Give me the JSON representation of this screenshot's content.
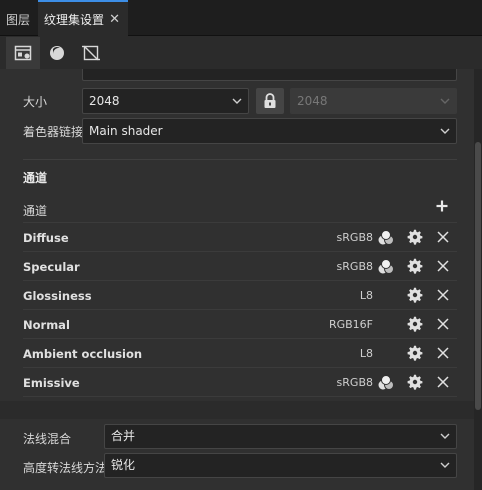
{
  "tabs": [
    {
      "label": "图层"
    },
    {
      "label": "纹理集设置"
    }
  ],
  "toolbar": {
    "buttons": [
      {
        "icon": "texture-set-icon"
      },
      {
        "icon": "shader-sphere-icon"
      },
      {
        "icon": "uv-crop-icon"
      }
    ]
  },
  "size": {
    "label": "大小",
    "value": "2048",
    "linked_value": "2048"
  },
  "shader_link": {
    "label": "着色器链接",
    "value": "Main shader"
  },
  "channels": {
    "title": "通道",
    "header_label": "通道",
    "items": [
      {
        "name": "Diffuse",
        "format": "sRGB8",
        "has_color": true
      },
      {
        "name": "Specular",
        "format": "sRGB8",
        "has_color": true
      },
      {
        "name": "Glossiness",
        "format": "L8",
        "has_color": false
      },
      {
        "name": "Normal",
        "format": "RGB16F",
        "has_color": false
      },
      {
        "name": "Ambient occlusion",
        "format": "L8",
        "has_color": false
      },
      {
        "name": "Emissive",
        "format": "sRGB8",
        "has_color": true
      }
    ]
  },
  "normal_blend": {
    "label": "法线混合",
    "value": "合并"
  },
  "height_to_normal": {
    "label": "高度转法线方法",
    "value": "锐化"
  },
  "colors": {
    "accent": "#3d8ee6",
    "panel": "#303030",
    "field": "#232323"
  }
}
